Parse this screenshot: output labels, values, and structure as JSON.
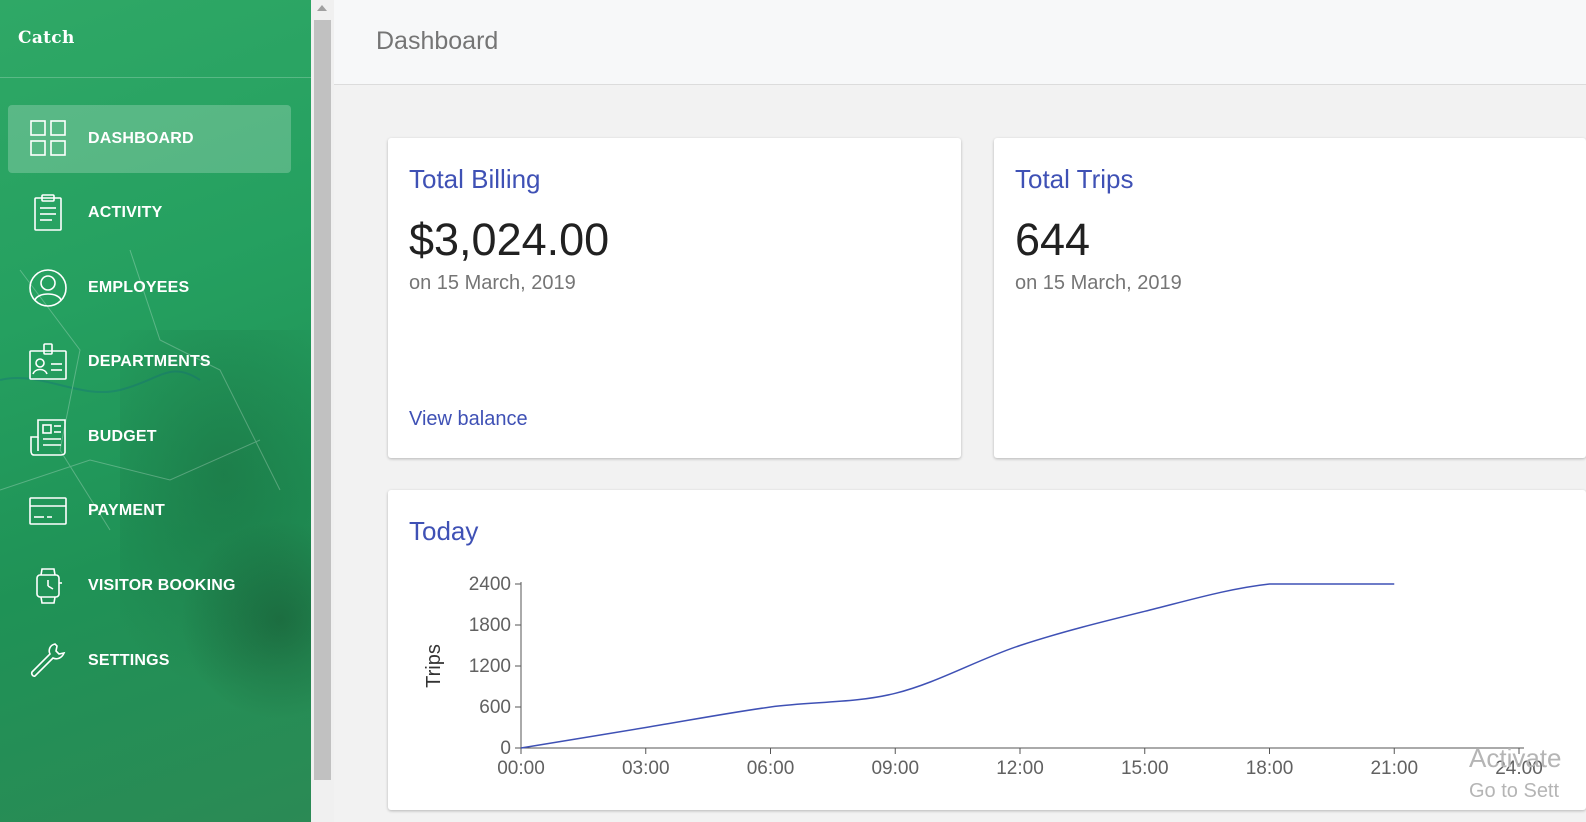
{
  "app": {
    "logo_text": "Catch"
  },
  "sidebar": {
    "items": [
      {
        "label": "DASHBOARD",
        "icon": "dashboard-icon",
        "active": true
      },
      {
        "label": "ACTIVITY",
        "icon": "clipboard-icon",
        "active": false
      },
      {
        "label": "EMPLOYEES",
        "icon": "user-circle-icon",
        "active": false
      },
      {
        "label": "DEPARTMENTS",
        "icon": "id-badge-icon",
        "active": false
      },
      {
        "label": "BUDGET",
        "icon": "newspaper-icon",
        "active": false
      },
      {
        "label": "PAYMENT",
        "icon": "credit-card-icon",
        "active": false
      },
      {
        "label": "VISITOR BOOKING",
        "icon": "smartwatch-icon",
        "active": false
      },
      {
        "label": "SETTINGS",
        "icon": "wrench-icon",
        "active": false
      }
    ]
  },
  "header": {
    "title": "Dashboard"
  },
  "cards": {
    "billing": {
      "title": "Total Billing",
      "value": "$3,024.00",
      "subtitle": "on 15 March, 2019",
      "link": "View balance"
    },
    "trips": {
      "title": "Total Trips",
      "value": "644",
      "subtitle": "on 15 March, 2019"
    }
  },
  "today": {
    "title": "Today"
  },
  "chart_data": {
    "type": "line",
    "title": "",
    "xlabel": "",
    "ylabel": "Trips",
    "x_ticks": [
      "00:00",
      "03:00",
      "06:00",
      "09:00",
      "12:00",
      "15:00",
      "18:00",
      "21:00",
      "24:00"
    ],
    "y_ticks": [
      0,
      600,
      1200,
      1800,
      2400
    ],
    "xlim": [
      0,
      24
    ],
    "ylim": [
      0,
      2400
    ],
    "series": [
      {
        "color": "#3f51b5",
        "x": [
          0,
          3,
          6,
          9,
          12,
          15,
          18,
          21
        ],
        "y": [
          0,
          300,
          600,
          800,
          1500,
          2000,
          2400,
          2400
        ]
      }
    ],
    "grid": false
  },
  "watermark": {
    "line1": "Activate",
    "line2": "Go to Sett"
  },
  "colors": {
    "accent": "#3f51b5",
    "sidebar_green": "#25a060"
  }
}
